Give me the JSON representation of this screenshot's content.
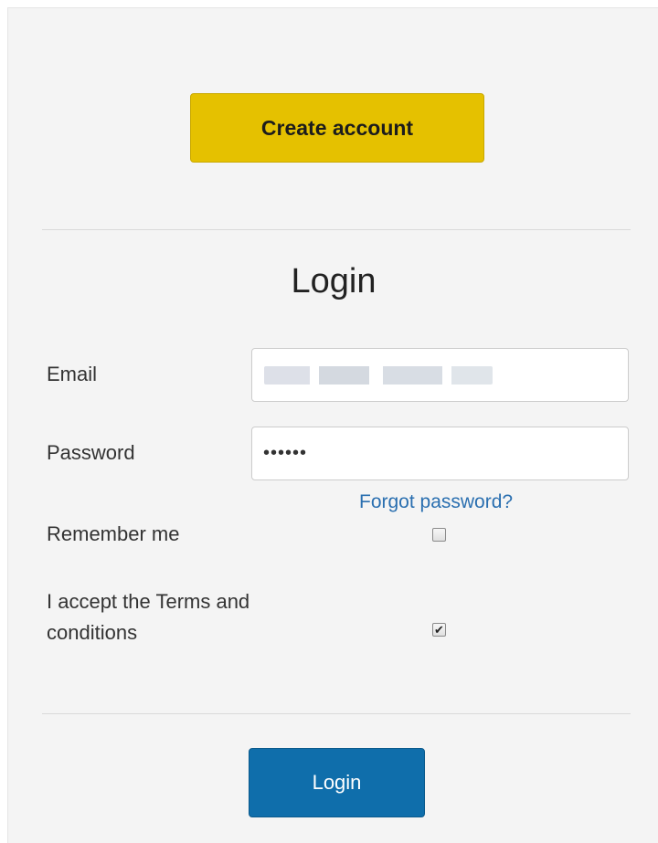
{
  "create_account": {
    "label": "Create account"
  },
  "login_form": {
    "title": "Login",
    "email": {
      "label": "Email",
      "value": ""
    },
    "password": {
      "label": "Password",
      "value": "••••••"
    },
    "forgot_password": "Forgot password?",
    "remember_me": {
      "label": "Remember me",
      "checked": false
    },
    "terms": {
      "label": "I accept the Terms and conditions",
      "checked": true
    },
    "submit_label": "Login"
  },
  "colors": {
    "create_button": "#e5c100",
    "login_button": "#0f6eab",
    "link": "#2a6fb0",
    "panel_background": "#f4f4f4"
  }
}
